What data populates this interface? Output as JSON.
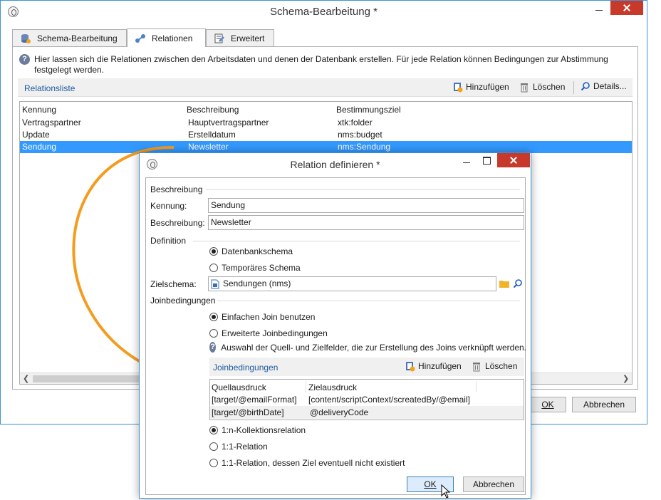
{
  "main_window": {
    "title": "Schema-Bearbeitung *",
    "tabs": [
      {
        "label": "Schema-Bearbeitung"
      },
      {
        "label": "Relationen"
      },
      {
        "label": "Erweitert"
      }
    ],
    "help_text": "Hier lassen sich die Relationen zwischen den Arbeitsdaten und denen der Datenbank erstellen. Für jede Relation können Bedingungen zur Abstimmung festgelegt werden.",
    "section_link": "Relationsliste",
    "toolbar": {
      "add": "Hinzufügen",
      "delete": "Löschen",
      "details": "Details..."
    },
    "table": {
      "columns": [
        "Kennung",
        "Beschreibung",
        "Bestimmungsziel"
      ],
      "rows": [
        [
          "Vertragspartner",
          "Hauptvertragspartner",
          "xtk:folder"
        ],
        [
          "Update",
          "Erstelldatum",
          "nms:budget"
        ],
        [
          "Sendung",
          "Newsletter",
          "nms:Sendung"
        ]
      ],
      "selected_row": 2
    },
    "ok_label": "OK",
    "cancel_label": "Abbrechen"
  },
  "dialog": {
    "title": "Relation definieren *",
    "description_group": "Beschreibung",
    "id_label": "Kennung:",
    "id_value": "Sendung",
    "desc_label": "Beschreibung:",
    "desc_value": "Newsletter",
    "definition_group": "Definition",
    "radio_db_schema": "Datenbankschema",
    "radio_temp_schema": "Temporäres Schema",
    "target_label": "Zielschema:",
    "target_value": "Sendungen (nms)",
    "join_group": "Joinbedingungen",
    "radio_simple_join": "Einfachen Join benutzen",
    "radio_advanced_join": "Erweiterte Joinbedingungen",
    "join_help": "Auswahl der Quell- und Zielfelder, die zur Erstellung des Joins verknüpft werden.",
    "join_link": "Joinbedingungen",
    "join_add": "Hinzufügen",
    "join_delete": "Löschen",
    "join_table": {
      "columns": [
        "Quellausdruck",
        "Zielausdruck"
      ],
      "rows": [
        [
          "[target/@emailFormat]",
          "[content/scriptContext/screatedBy/@email]"
        ],
        [
          "[target/@birthDate]",
          "@deliveryCode"
        ]
      ]
    },
    "radio_1n": "1:n-Kollektionsrelation",
    "radio_11": "1:1-Relation",
    "radio_11_opt": "1:1-Relation, dessen Ziel eventuell nicht existiert",
    "ok_label": "OK",
    "cancel_label": "Abbrechen"
  },
  "colors": {
    "selection": "#3399ff",
    "accent_border": "#3c94d4",
    "arrow": "#f39c1f",
    "close_button": "#c7392b"
  }
}
